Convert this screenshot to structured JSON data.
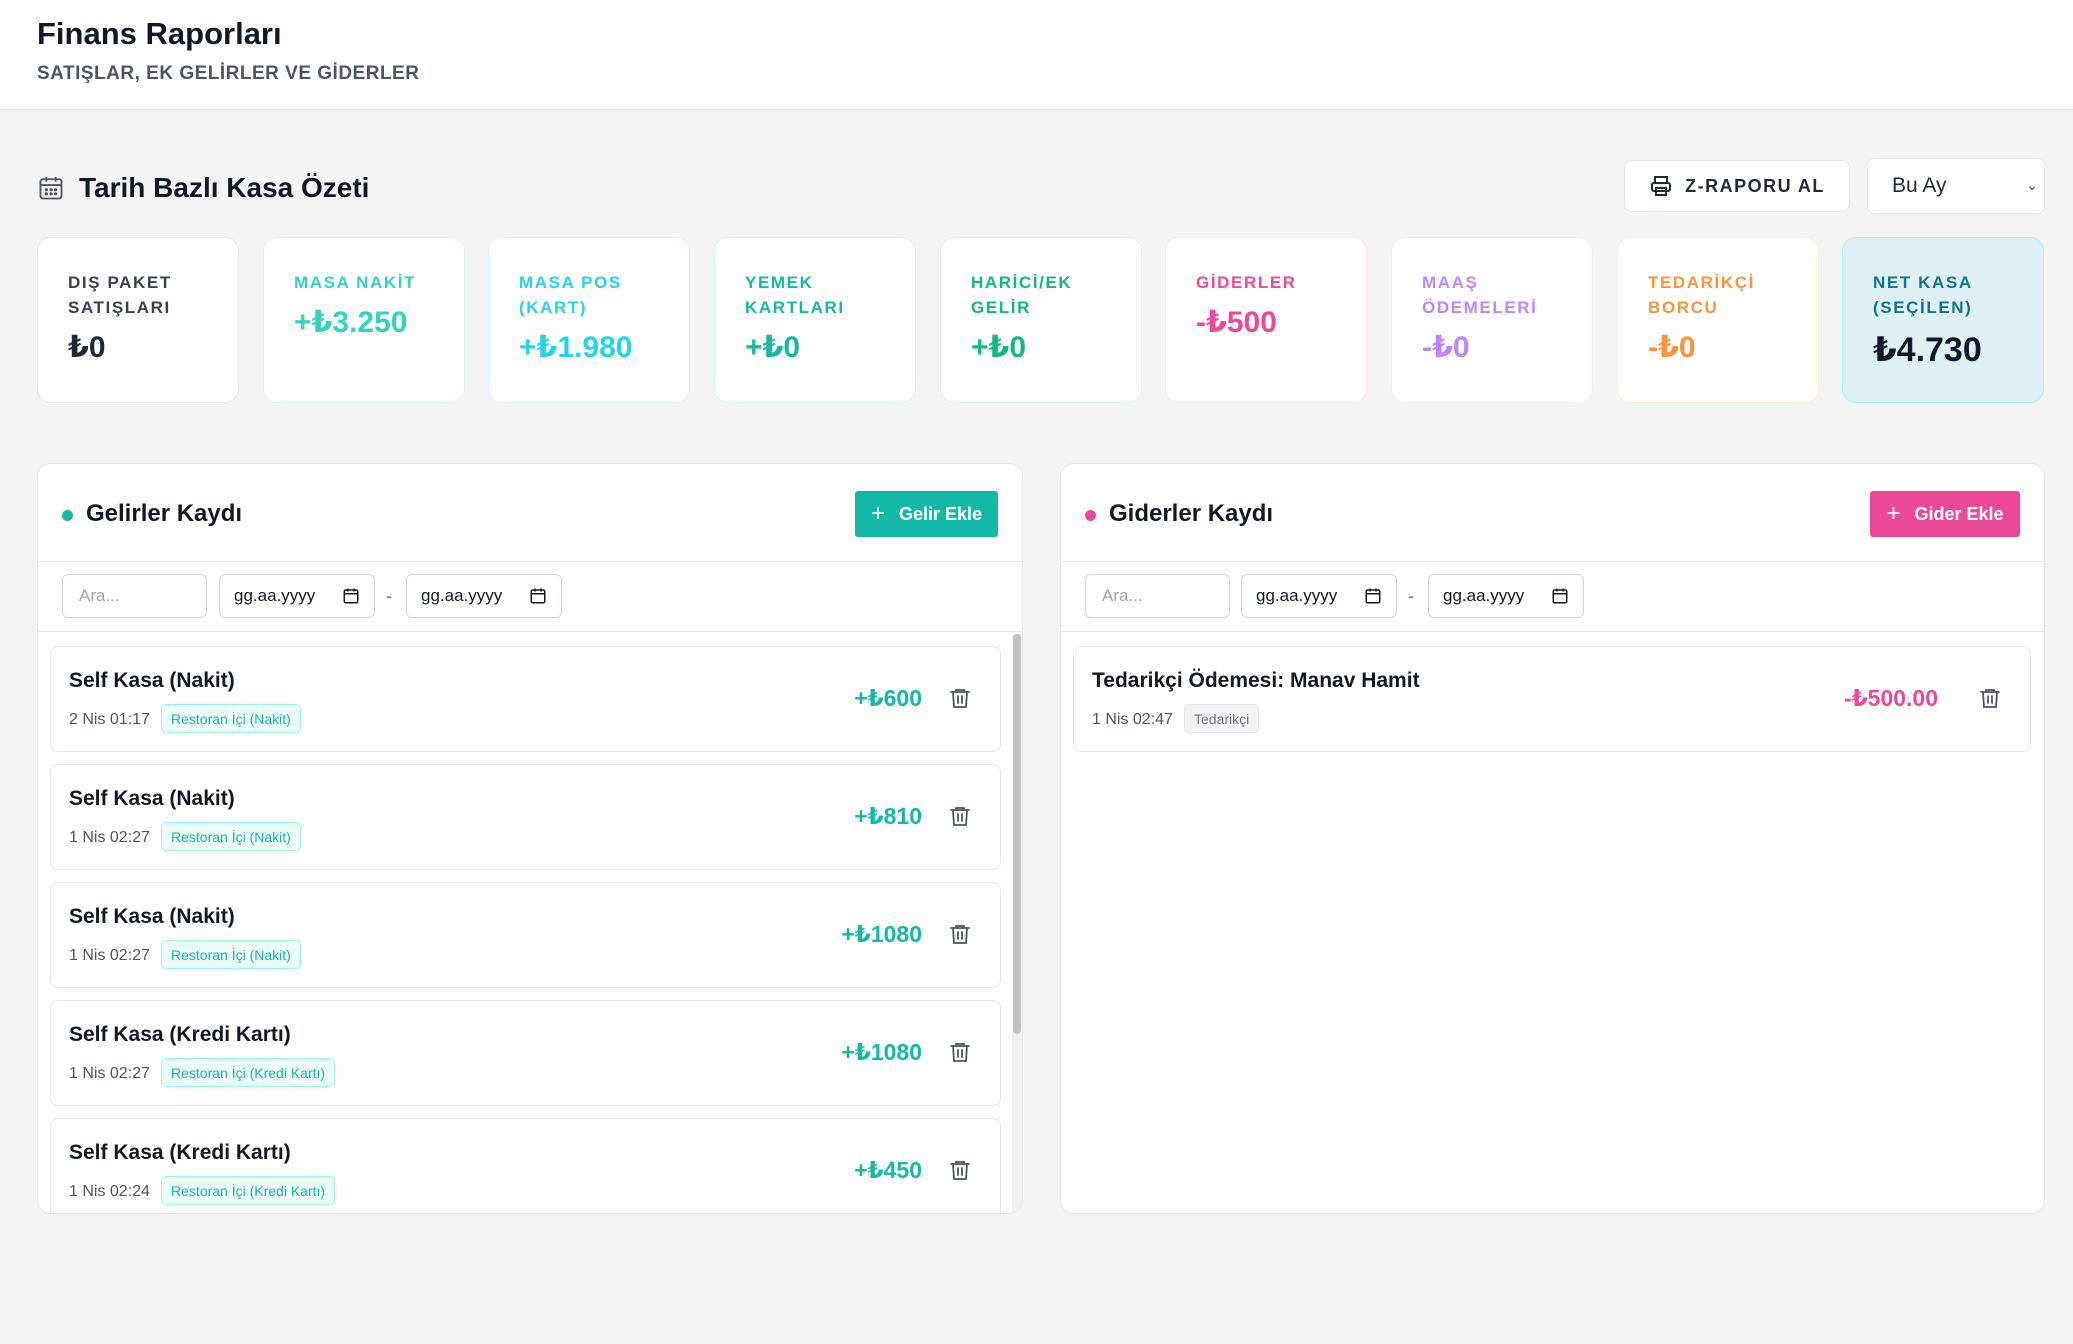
{
  "header": {
    "title": "Finans Raporları",
    "subtitle": "SATIŞLAR, EK GELİRLER VE GİDERLER"
  },
  "summary": {
    "title": "Tarih Bazlı Kasa Özeti",
    "icon": "calendar-icon",
    "zreport_label": "Z-RAPORU AL",
    "period_selected": "Bu Ay"
  },
  "cards": [
    {
      "name": "card-dis-paket",
      "label": "DIŞ PAKET SATIŞLARI",
      "value": "₺0",
      "color": "#1f2937",
      "label_color": "#374151",
      "border": "#e5e7eb",
      "bg": "#ffffff"
    },
    {
      "name": "card-masa-nakit",
      "label": "MASA NAKİT",
      "value": "+₺3.250",
      "color": "#2dd4bf",
      "label_color": "#2dd4bf",
      "border": "#ccfbf1",
      "bg": "#ffffff"
    },
    {
      "name": "card-masa-pos",
      "label": "MASA POS (KART)",
      "value": "+₺1.980",
      "color": "#22d3ee",
      "label_color": "#22d3ee",
      "border": "#cffafe",
      "bg": "#ffffff"
    },
    {
      "name": "card-yemek-kartlari",
      "label": "YEMEK KARTLARI",
      "value": "+₺0",
      "color": "#14b8a6",
      "label_color": "#14b8a6",
      "border": "#ccfbf1",
      "bg": "#ffffff"
    },
    {
      "name": "card-harici-gelir",
      "label": "HARİCİ/EK GELİR",
      "value": "+₺0",
      "color": "#10b981",
      "label_color": "#10b981",
      "border": "#d1fae5",
      "bg": "#ffffff"
    },
    {
      "name": "card-giderler",
      "label": "GİDERLER",
      "value": "-₺500",
      "color": "#ec4899",
      "label_color": "#ec4899",
      "border": "#fce7f3",
      "bg": "#ffffff"
    },
    {
      "name": "card-maas",
      "label": "MAAŞ ÖDEMELERİ",
      "value": "-₺0",
      "color": "#c084fc",
      "label_color": "#c084fc",
      "border": "#f3e8ff",
      "bg": "#ffffff"
    },
    {
      "name": "card-tedarikci",
      "label": "TEDARİKÇİ BORCU",
      "value": "-₺0",
      "color": "#fb923c",
      "label_color": "#fb923c",
      "border": "#ffedd5",
      "bg": "#ffffff"
    },
    {
      "name": "card-net-kasa",
      "label": "NET KASA (SEÇİLEN)",
      "value": "₺4.730",
      "color": "#111827",
      "label_color": "#0e7490",
      "border": "#a5f3fc",
      "bg": "#dff0f3"
    }
  ],
  "income": {
    "title": "Gelirler Kaydı",
    "add_label": "Gelir Ekle",
    "accent": "#14b8a6",
    "search_placeholder": "Ara...",
    "date_from": "gg.aa.yyyy",
    "date_to": "gg.aa.yyyy",
    "separator": "-",
    "rows": [
      {
        "title": "Self Kasa (Nakit)",
        "time": "2 Nis 01:17",
        "tag": "Restoran İçi (Nakit)",
        "amount": "+₺600"
      },
      {
        "title": "Self Kasa (Nakit)",
        "time": "1 Nis 02:27",
        "tag": "Restoran İçi (Nakit)",
        "amount": "+₺810"
      },
      {
        "title": "Self Kasa (Nakit)",
        "time": "1 Nis 02:27",
        "tag": "Restoran İçi (Nakit)",
        "amount": "+₺1080"
      },
      {
        "title": "Self Kasa (Kredi Kartı)",
        "time": "1 Nis 02:27",
        "tag": "Restoran İçi (Kredi Kartı)",
        "amount": "+₺1080"
      },
      {
        "title": "Self Kasa (Kredi Kartı)",
        "time": "1 Nis 02:24",
        "tag": "Restoran İçi (Kredi Kartı)",
        "amount": "+₺450"
      }
    ]
  },
  "expense": {
    "title": "Giderler Kaydı",
    "add_label": "Gider Ekle",
    "accent": "#ec4899",
    "search_placeholder": "Ara...",
    "date_from": "gg.aa.yyyy",
    "date_to": "gg.aa.yyyy",
    "separator": "-",
    "rows": [
      {
        "title": "Tedarikçi Ödemesi: Manav Hamit",
        "time": "1 Nis 02:47",
        "tag": "Tedarikçi",
        "amount": "-₺500.00"
      }
    ]
  }
}
